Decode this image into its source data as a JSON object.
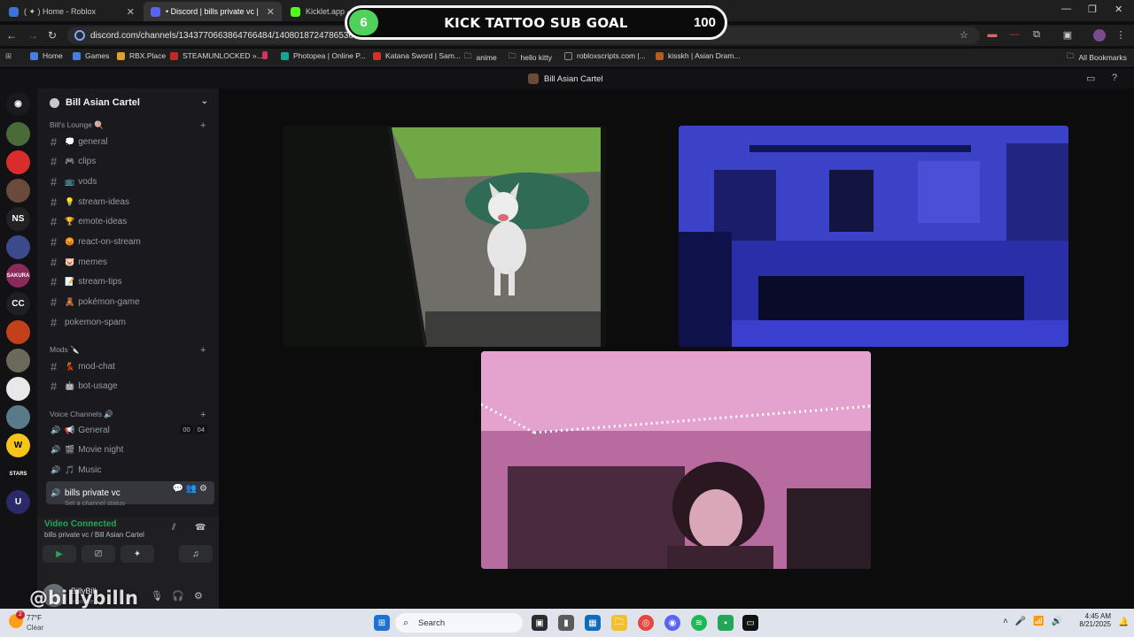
{
  "browser": {
    "tabs": [
      {
        "label": "( ✦ ) Home - Roblox",
        "active": false
      },
      {
        "label": "• Discord | bills private vc |",
        "active": true
      },
      {
        "label": "Kicklet.app - K… bot and …",
        "active": false
      }
    ],
    "new_tab": "+",
    "url": "discord.com/channels/1343770663864766484/1408018724786536508",
    "bookmarks": [
      "Home",
      "Games",
      "RBX.Place",
      "STEAMUNLOCKED »...",
      "Photopea | Online P...",
      "Katana Sword | Sam...",
      "anime",
      "hello kitty",
      "robloxscripts.com |...",
      "kisskh | Asian Dram...",
      "All Bookmarks"
    ],
    "window_controls": [
      "—",
      "❐",
      "✕"
    ]
  },
  "subgoal": {
    "count": "6",
    "title": "KICK TATTOO SUB GOAL",
    "goal": "100"
  },
  "discord": {
    "title_server": "Bill Asian Cartel",
    "guild_name": "Bill Asian Cartel",
    "categories": [
      {
        "label": "Bill's Lounge 🍭"
      },
      {
        "label": "Mods 🔪"
      },
      {
        "label": "Voice Channels 🔊"
      }
    ],
    "text_channels": [
      {
        "emoji": "💭",
        "name": "general"
      },
      {
        "emoji": "🎮",
        "name": "clips"
      },
      {
        "emoji": "📺",
        "name": "vods"
      },
      {
        "emoji": "💡",
        "name": "stream-ideas"
      },
      {
        "emoji": "🏆",
        "name": "emote-ideas"
      },
      {
        "emoji": "😡",
        "name": "react-on-stream"
      },
      {
        "emoji": "🐷",
        "name": "memes"
      },
      {
        "emoji": "📝",
        "name": "stream-tips"
      },
      {
        "emoji": "🧸",
        "name": "pokémon-game"
      },
      {
        "emoji": "",
        "name": "pokemon-spam"
      }
    ],
    "mod_channels": [
      {
        "emoji": "💃",
        "name": "mod-chat"
      },
      {
        "emoji": "🤖",
        "name": "bot-usage"
      }
    ],
    "voice_channels": [
      {
        "emoji": "📢",
        "name": "General",
        "badge": [
          "00",
          "04"
        ]
      },
      {
        "emoji": "🎬",
        "name": "Movie night"
      },
      {
        "emoji": "🎵",
        "name": "Music"
      },
      {
        "emoji": "",
        "name": "bills private vc",
        "active": true
      }
    ],
    "channel_status": "Set a channel status",
    "voice_panel": {
      "status": "Video Connected",
      "location": "bills private vc / Bill Asian Cartel"
    },
    "user": {
      "name": "BillyBill",
      "status": "In voice"
    }
  },
  "watermark": "@billybilln",
  "taskbar": {
    "weather_temp": "77°F",
    "weather_cond": "Clear",
    "weather_badge": "2",
    "search_placeholder": "Search",
    "time": "4:45 AM",
    "date": "8/21/2025"
  },
  "colors": {
    "accent_green": "#23a55a",
    "subgoal_green": "#4fd15a",
    "stage_bg": "#0c0c0d"
  }
}
